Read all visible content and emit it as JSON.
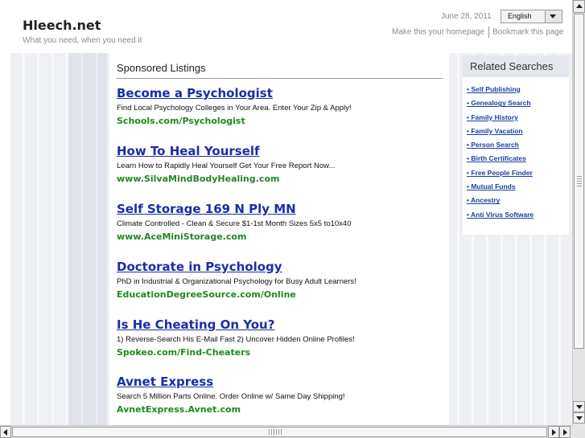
{
  "header": {
    "site_title": "Hleech.net",
    "tagline": "What you need, when you need it",
    "date": "June 28, 2011",
    "language": "English",
    "make_homepage": "Make this your homepage",
    "bookmark": "Bookmark this page"
  },
  "sponsored": {
    "heading": "Sponsored Listings",
    "ads": [
      {
        "title": "Become a Psychologist",
        "desc": "Find Local Psychology Colleges in Your Area. Enter Your Zip & Apply!",
        "url": "Schools.com/Psychologist"
      },
      {
        "title": "How To Heal Yourself",
        "desc": "Learn How to Rapidly Heal Yourself Get Your Free Report Now...",
        "url": "www.SilvaMindBodyHealing.com"
      },
      {
        "title": "Self Storage 169 N Ply MN",
        "desc": "Climate Controlled - Clean & Secure $1-1st Month Sizes 5x5 to10x40",
        "url": "www.AceMiniStorage.com"
      },
      {
        "title": "Doctorate in Psychology",
        "desc": "PhD in Industrial & Organizational Psychology for Busy Adult Learners!",
        "url": "EducationDegreeSource.com/Online"
      },
      {
        "title": "Is He Cheating On You?",
        "desc": "1) Reverse-Search His E-Mail Fast 2) Uncover Hidden Online Profiles!",
        "url": "Spokeo.com/Find-Cheaters"
      },
      {
        "title": "Avnet Express",
        "desc": "Search 5 Million Parts Online. Order Online w/ Same Day Shipping!",
        "url": "AvnetExpress.Avnet.com"
      }
    ]
  },
  "related": {
    "heading": "Related Searches",
    "items": [
      "• Self Publishing",
      "• Genealogy Search",
      "• Family History",
      "• Family Vacation",
      "• Person Search",
      "• Birth Certificates",
      "• Free People Finder",
      "• Mutual Funds",
      "• Ancestry",
      "• Anti Virus Software"
    ]
  },
  "colors": {
    "link_blue": "#1a2ea8",
    "url_green": "#1e8a1e",
    "related_head_bg": "#e5e7ee"
  },
  "icons": {
    "lang_dropdown": "chevron-down-icon",
    "scroll_up": "arrow-up-icon",
    "scroll_down": "arrow-down-icon",
    "scroll_left": "arrow-left-icon",
    "scroll_right": "arrow-right-icon"
  }
}
